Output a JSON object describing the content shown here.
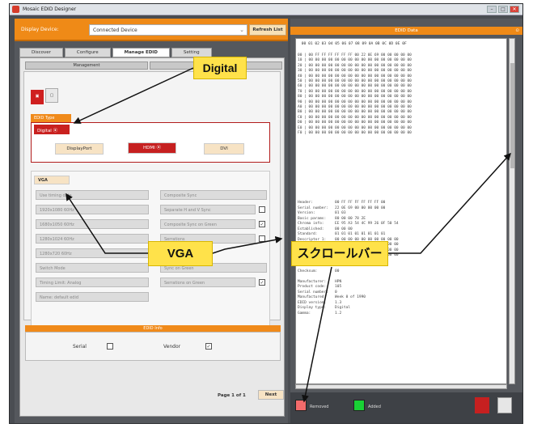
{
  "window": {
    "title": "Mosaic EDID Designer"
  },
  "toolbar": {
    "device_label": "Display Device:",
    "device_value": "Connected Device",
    "refresh_label": "Refresh List"
  },
  "tabs": [
    "Discover",
    "Configure",
    "Manage EDID",
    "Setting"
  ],
  "panel": {
    "management_label": "Management",
    "edid_type_label": "EDID Type",
    "digital_label": "Digital",
    "digital_options": [
      "DisplayPort",
      "HDMI",
      "DVI"
    ],
    "vga_label": "VGA",
    "rows_left": [
      "Use timing data",
      "1920x1080 60Hz",
      "1680x1050 60Hz",
      "1280x1024 60Hz",
      "1280x720 60Hz",
      "Switch Mode",
      "Timing Limit: Analog",
      "Name: default edid"
    ],
    "rows_right": [
      "Composite Sync",
      "Separate H and V Sync",
      "Composite Sync on Green",
      "Serrations",
      "Sync on Green",
      "Serrations on Green"
    ],
    "check_states": [
      false,
      true,
      false,
      true
    ],
    "header_bar": "EDID Info",
    "header_fields": [
      "Serial",
      "Vendor"
    ],
    "page_label": "Page 1 of 1",
    "next_label": "Next"
  },
  "right": {
    "title": "EDID Data",
    "hex_header": " 00 01 02 03 04 05 06 07 08 09 0A 0B 0C 0D 0E 0F",
    "hex_rows": [
      "00 | 00 FF FF FF FF FF FF 00 22 0E 69 00 00 00 00 00",
      "10 | 00 00 00 00 00 00 00 00 00 00 00 00 00 00 00 00",
      "20 | 00 00 00 00 00 00 00 00 00 00 00 00 00 00 00 00",
      "30 | 00 00 00 00 00 00 00 00 00 00 00 00 00 00 00 00",
      "40 | 00 00 00 00 00 00 00 00 00 00 00 00 00 00 00 00",
      "50 | 00 00 00 00 00 00 00 00 00 00 00 00 00 00 00 00",
      "60 | 00 00 00 00 00 00 00 00 00 00 00 00 00 00 00 00",
      "70 | 00 00 00 00 00 00 00 00 00 00 00 00 00 00 00 00",
      "80 | 00 00 00 00 00 00 00 00 00 00 00 00 00 00 00 00",
      "90 | 00 00 00 00 00 00 00 00 00 00 00 00 00 00 00 00",
      "A0 | 00 00 00 00 00 00 00 00 00 00 00 00 00 00 00 00",
      "B0 | 00 00 00 00 00 00 00 00 00 00 00 00 00 00 00 00",
      "C0 | 00 00 00 00 00 00 00 00 00 00 00 00 00 00 00 00",
      "D0 | 00 00 00 00 00 00 00 00 00 00 00 00 00 00 00 00",
      "E0 | 00 00 00 00 00 00 00 00 00 00 00 00 00 00 00 00",
      "F0 | 00 00 00 00 00 00 00 00 00 00 00 00 00 00 00 00"
    ],
    "decode_lines": [
      "Header:          00 FF FF FF FF FF FF 00",
      "Serial number:   22 0E 69 00 00 00 00 00",
      "Version:         01 03",
      "Basic params:    80 00 00 78 2E",
      "Chroma info:     EE 95 A3 54 4C 99 26 0F 50 54",
      "Established:     00 00 00",
      "Standard:        01 01 01 01 01 01 01 01",
      "Descriptor 1:    00 00 00 00 00 00 00 00 00 00",
      "Descriptor 2:    00 00 00 00 00 00 00 00 00 00",
      "Descriptor 3:    00 00 00 00 00 00 00 00 00 00",
      "Descriptor 4:    00 00 00 00 00 00 00 00 00 00",
      "",
      "Extensions:      00",
      "Checksum:        00",
      "",
      "Manufacturer:    HPN",
      "Product code:    105",
      "Serial number:   0",
      "Manufactured:    Week 0 of 1990",
      "EDID version:    1.3",
      "Display type:    Digital",
      "Gamma:           1.2"
    ],
    "status_labels": [
      "Removed",
      "Added"
    ]
  },
  "annotations": {
    "digital": "Digital",
    "vga": "VGA",
    "scrollbar": "スクロールバー"
  },
  "colors": {
    "orange": "#EF8A17",
    "red": "#C62020",
    "yellow": "#FFE24A"
  }
}
